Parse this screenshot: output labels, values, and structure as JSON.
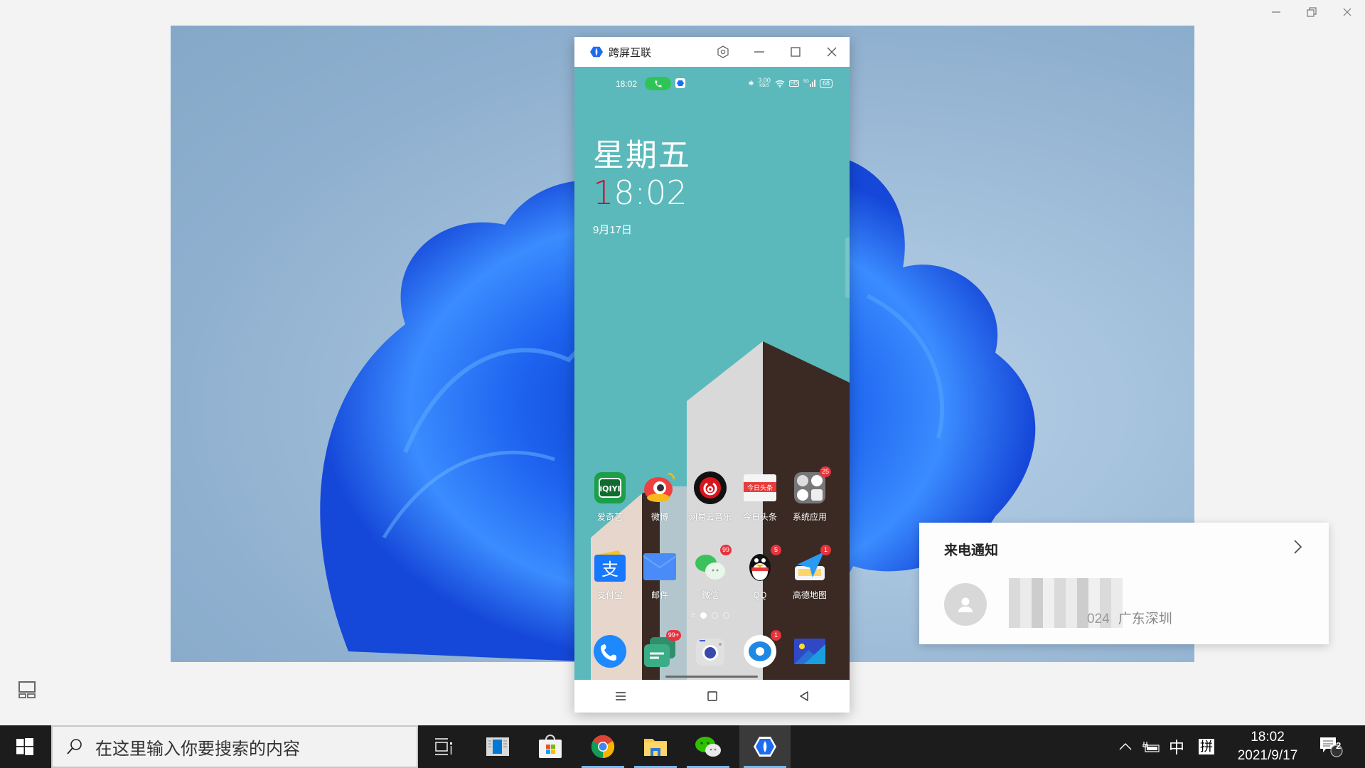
{
  "window": {
    "controls": [
      "minimize",
      "restore",
      "close"
    ]
  },
  "phone_window": {
    "title": "跨屏互联",
    "toolbar_icons": [
      "settings-icon",
      "minimize-icon",
      "maximize-icon",
      "close-icon"
    ],
    "status_bar": {
      "time": "18:02",
      "net_speed_value": "3.00",
      "net_speed_unit": "KB/S",
      "hd_label": "HD",
      "network": "5G",
      "battery": "68"
    },
    "lock_widget": {
      "weekday": "星期五",
      "time_first_digit": "1",
      "time_rest": "8:02",
      "date": "9月17日"
    },
    "app_rows": [
      [
        {
          "name": "爱奇艺",
          "icon": "iqiyi-icon",
          "badge": null
        },
        {
          "name": "微博",
          "icon": "weibo-icon",
          "badge": null
        },
        {
          "name": "网易云音乐",
          "icon": "netease-music-icon",
          "badge": null
        },
        {
          "name": "今日头条",
          "icon": "toutiao-icon",
          "badge": null
        },
        {
          "name": "系统应用",
          "icon": "system-apps-folder-icon",
          "badge": "25"
        }
      ],
      [
        {
          "name": "支付宝",
          "icon": "alipay-icon",
          "badge": null
        },
        {
          "name": "邮件",
          "icon": "mail-icon",
          "badge": null
        },
        {
          "name": "微信",
          "icon": "wechat-icon",
          "badge": "99"
        },
        {
          "name": "QQ",
          "icon": "qq-icon",
          "badge": "5"
        },
        {
          "name": "高德地图",
          "icon": "amap-icon",
          "badge": "1"
        }
      ]
    ],
    "dock": [
      {
        "icon": "phone-icon",
        "badge": null
      },
      {
        "icon": "messages-icon",
        "badge": "99+"
      },
      {
        "icon": "camera-icon",
        "badge": null
      },
      {
        "icon": "browser-icon",
        "badge": "1"
      },
      {
        "icon": "gallery-icon",
        "badge": null
      }
    ],
    "page_indicator": {
      "pages": 3,
      "current": 1
    },
    "nav_buttons": [
      "menu",
      "home",
      "back"
    ]
  },
  "notification": {
    "title": "来电通知",
    "caller_number_partial": "024",
    "caller_location": "广东深圳"
  },
  "taskbar": {
    "search_placeholder": "在这里输入你要搜索的内容",
    "pinned": [
      "task-view",
      "news",
      "store",
      "chrome",
      "file-explorer",
      "wechat",
      "cross-screen-app"
    ],
    "tray": {
      "ime_mode": "中",
      "ime_name": "拼",
      "time": "18:02",
      "date": "2021/9/17",
      "notification_count": "2"
    }
  }
}
